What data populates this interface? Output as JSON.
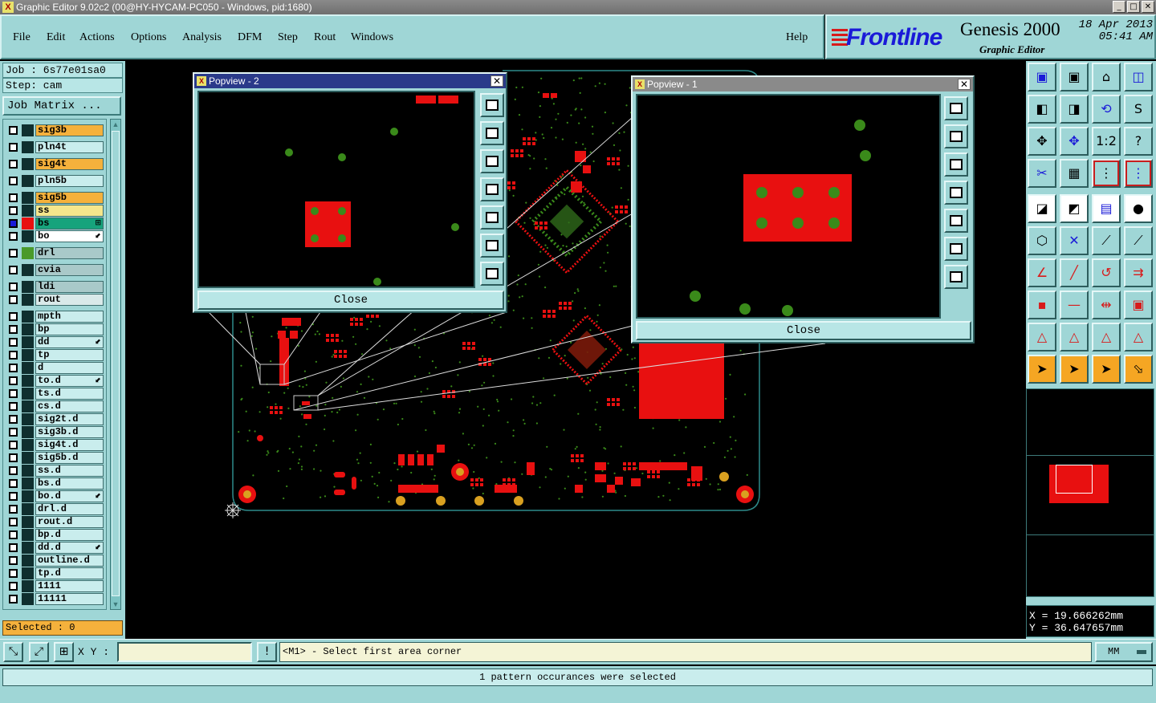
{
  "window": {
    "title": "Graphic Editor 9.02c2 (00@HY-HYCAM-PC050 - Windows, pid:1680)",
    "buttons": [
      "_",
      "□",
      "✕"
    ]
  },
  "menu": {
    "items": [
      "File",
      "Edit",
      "Actions",
      "Options",
      "Analysis",
      "DFM",
      "Step",
      "Rout",
      "Windows"
    ],
    "help": "Help"
  },
  "brand": {
    "logo": "Frontline",
    "product": "Genesis 2000",
    "subtitle": "Graphic Editor",
    "date": "18 Apr 2013",
    "time": "05:41 AM",
    "logo_color": "#1a1ad8"
  },
  "left": {
    "job": "Job : 6s77e01sa0",
    "step": "Step: cam",
    "job_matrix": "Job Matrix ...",
    "layers": [
      {
        "name": "sig3b",
        "color": "#f5b13c",
        "swatch": "#0f2f2f",
        "mark": ""
      },
      {
        "name": "pln4t",
        "color": "#c9eded",
        "swatch": "#0f2f2f",
        "mark": ""
      },
      {
        "name": "sig4t",
        "color": "#f5b13c",
        "swatch": "#0f2f2f",
        "mark": ""
      },
      {
        "name": "pln5b",
        "color": "#c9eded",
        "swatch": "#0f2f2f",
        "mark": ""
      },
      {
        "name": "sig5b",
        "color": "#f5b13c",
        "swatch": "#0f2f2f",
        "mark": ""
      },
      {
        "name": "ss",
        "color": "#f5e68c",
        "swatch": "#0f2f2f",
        "mark": ""
      },
      {
        "name": "bs",
        "color": "#16a37c",
        "swatch": "#e81010",
        "mark": "⊞"
      },
      {
        "name": "bo",
        "color": "#ffffff",
        "swatch": "#0f2f2f",
        "mark": "⬋"
      },
      {
        "name": "drl",
        "color": "#a9c9c9",
        "swatch": "#4a9a2a",
        "mark": ""
      },
      {
        "name": "cvia",
        "color": "#a9c9c9",
        "swatch": "#0f2f2f",
        "mark": ""
      },
      {
        "name": "ldi",
        "color": "#a9c9c9",
        "swatch": "#0f2f2f",
        "mark": ""
      },
      {
        "name": "rout",
        "color": "#d9e9e9",
        "swatch": "#0f2f2f",
        "mark": ""
      },
      {
        "name": "mpth",
        "color": "#c9eded",
        "swatch": "#0f2f2f",
        "mark": ""
      },
      {
        "name": "bp",
        "color": "#c9eded",
        "swatch": "#0f2f2f",
        "mark": ""
      },
      {
        "name": "dd",
        "color": "#c9eded",
        "swatch": "#0f2f2f",
        "mark": "⬋"
      },
      {
        "name": "tp",
        "color": "#c9eded",
        "swatch": "#0f2f2f",
        "mark": ""
      },
      {
        "name": "d",
        "color": "#c9eded",
        "swatch": "#0f2f2f",
        "mark": ""
      },
      {
        "name": "to.d",
        "color": "#c9eded",
        "swatch": "#0f2f2f",
        "mark": "⬋"
      },
      {
        "name": "ts.d",
        "color": "#c9eded",
        "swatch": "#0f2f2f",
        "mark": ""
      },
      {
        "name": "cs.d",
        "color": "#c9eded",
        "swatch": "#0f2f2f",
        "mark": ""
      },
      {
        "name": "sig2t.d",
        "color": "#c9eded",
        "swatch": "#0f2f2f",
        "mark": ""
      },
      {
        "name": "sig3b.d",
        "color": "#c9eded",
        "swatch": "#0f2f2f",
        "mark": ""
      },
      {
        "name": "sig4t.d",
        "color": "#c9eded",
        "swatch": "#0f2f2f",
        "mark": ""
      },
      {
        "name": "sig5b.d",
        "color": "#c9eded",
        "swatch": "#0f2f2f",
        "mark": ""
      },
      {
        "name": "ss.d",
        "color": "#c9eded",
        "swatch": "#0f2f2f",
        "mark": ""
      },
      {
        "name": "bs.d",
        "color": "#c9eded",
        "swatch": "#0f2f2f",
        "mark": ""
      },
      {
        "name": "bo.d",
        "color": "#c9eded",
        "swatch": "#0f2f2f",
        "mark": "⬋"
      },
      {
        "name": "drl.d",
        "color": "#c9eded",
        "swatch": "#0f2f2f",
        "mark": ""
      },
      {
        "name": "rout.d",
        "color": "#c9eded",
        "swatch": "#0f2f2f",
        "mark": ""
      },
      {
        "name": "bp.d",
        "color": "#c9eded",
        "swatch": "#0f2f2f",
        "mark": ""
      },
      {
        "name": "dd.d",
        "color": "#c9eded",
        "swatch": "#0f2f2f",
        "mark": "⬋"
      },
      {
        "name": "outline.d",
        "color": "#c9eded",
        "swatch": "#0f2f2f",
        "mark": ""
      },
      {
        "name": "tp.d",
        "color": "#c9eded",
        "swatch": "#0f2f2f",
        "mark": ""
      },
      {
        "name": "1111",
        "color": "#c9eded",
        "swatch": "#0f2f2f",
        "mark": ""
      },
      {
        "name": "11111",
        "color": "#c9eded",
        "swatch": "#0f2f2f",
        "mark": ""
      }
    ],
    "selected": "Selected : 0"
  },
  "popview2": {
    "title": "Popview - 2",
    "close": "Close"
  },
  "popview1": {
    "title": "Popview - 1",
    "close": "Close"
  },
  "coords": {
    "x": "X = 19.666262mm",
    "y": "Y = 36.647657mm"
  },
  "bottom": {
    "xy_label": "X Y :",
    "xy_value": "",
    "prompt": "<M1> - Select first area corner",
    "units": "MM",
    "status": "1 pattern occurances were selected"
  },
  "colors": {
    "panel": "#9fd6d6",
    "copper": "#e81010",
    "drill": "#3a8a1a"
  }
}
